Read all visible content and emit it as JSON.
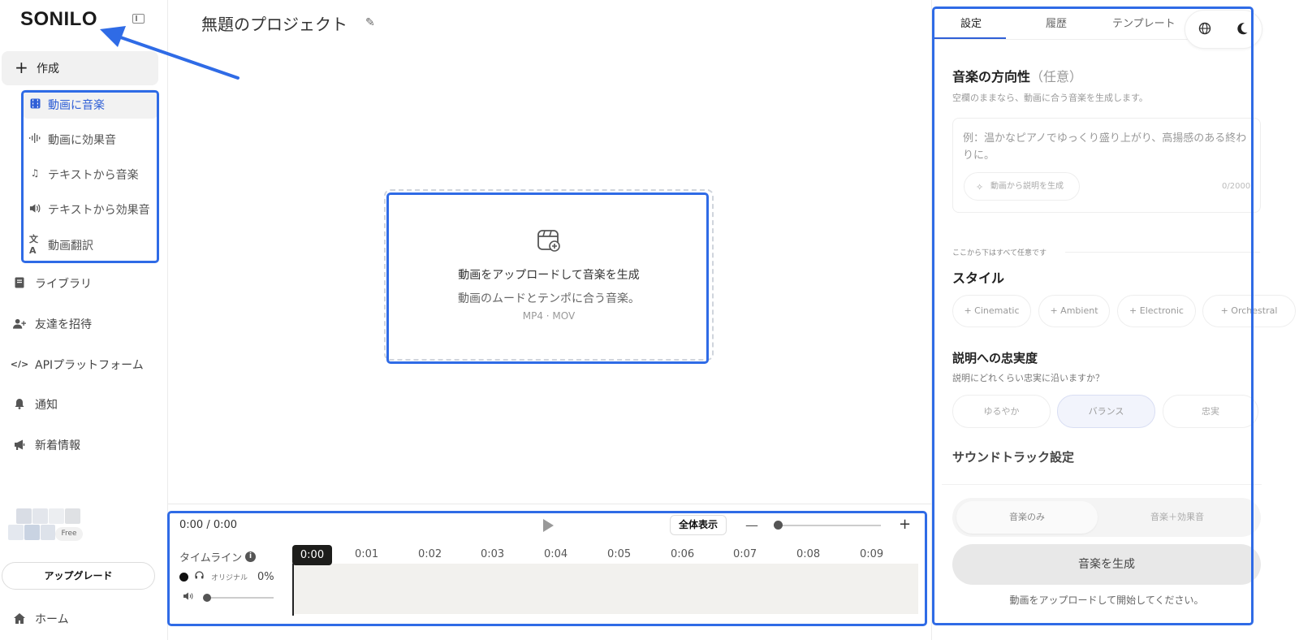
{
  "sidebar": {
    "logo": "SONILO",
    "create_label": "作成",
    "sub_items": [
      {
        "label": "動画に音楽",
        "icon": "film-icon",
        "active": true
      },
      {
        "label": "動画に効果音",
        "icon": "waveform-icon"
      },
      {
        "label": "テキストから音楽",
        "icon": "music-note-icon"
      },
      {
        "label": "テキストから効果音",
        "icon": "speaker-icon"
      },
      {
        "label": "動画翻訳",
        "icon": "translate-icon"
      }
    ],
    "nav_items": [
      {
        "label": "ライブラリ",
        "icon": "book-icon"
      },
      {
        "label": "友達を招待",
        "icon": "person-add-icon"
      },
      {
        "label": "APIプラットフォーム",
        "icon": "code-icon"
      },
      {
        "label": "通知",
        "icon": "bell-icon"
      },
      {
        "label": "新着情報",
        "icon": "megaphone-icon"
      }
    ],
    "plan_badge": "Free",
    "upgrade_label": "アップグレード",
    "home_label": "ホーム"
  },
  "main": {
    "project_title": "無題のプロジェクト",
    "upload": {
      "title": "動画をアップロードして音楽を生成",
      "subtitle": "動画のムードとテンポに合う音楽。",
      "formats": "MP4 · MOV"
    }
  },
  "timeline": {
    "time_display": "0:00 / 0:00",
    "fit_label": "全体表示",
    "label": "タイムライン",
    "zoom_level": 0,
    "ticks": [
      "0:00",
      "0:01",
      "0:02",
      "0:03",
      "0:04",
      "0:05",
      "0:06",
      "0:07",
      "0:08",
      "0:09"
    ],
    "track": {
      "name": "オリジナル",
      "percent": "0%"
    },
    "volume_level": 0
  },
  "panel": {
    "tabs": [
      "設定",
      "履歴",
      "テンプレート"
    ],
    "active_tab": "設定",
    "direction_title": "音楽の方向性",
    "direction_optional": "（任意）",
    "direction_hint": "空欄のままなら、動画に合う音楽を生成します。",
    "textarea_placeholder": "例：温かなピアノでゆっくり盛り上がり、高揚感のある終わりに。",
    "describe_button": "動画から説明を生成",
    "char_count": "0/2000",
    "optional_note": "ここから下はすべて任意です",
    "style_title": "スタイル",
    "style_chips": [
      "+ Cinematic",
      "+ Ambient",
      "+ Electronic",
      "+ Orchestral"
    ],
    "fidelity_title": "説明への忠実度",
    "fidelity_hint": "説明にどれくらい忠実に沿いますか？",
    "fidelity_options": [
      "ゆるやか",
      "バランス",
      "忠実"
    ],
    "fidelity_selected": "バランス",
    "soundtrack_title": "サウンドトラック設定",
    "mode_options": [
      "音楽のみ",
      "音楽＋効果音"
    ],
    "generate_label": "音楽を生成",
    "footer_hint": "動画をアップロードして開始してください。"
  },
  "colors": {
    "accent": "#2f5fd6",
    "highlight": "#2f6be6",
    "dark": "#1d1d1b"
  }
}
